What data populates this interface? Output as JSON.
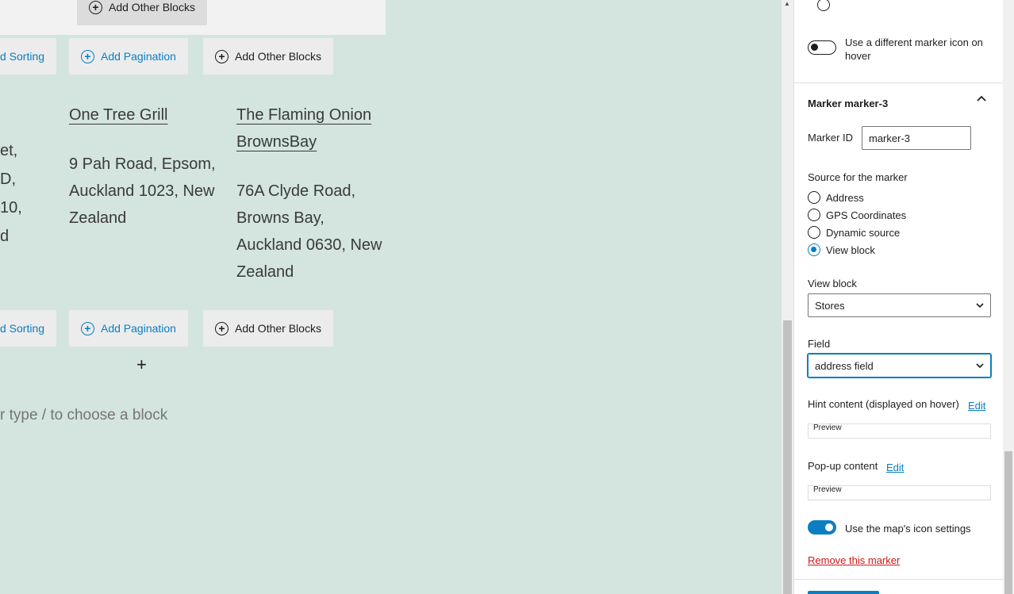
{
  "canvas": {
    "buttons": {
      "add_sorting": "d Sorting",
      "add_pagination": "Add Pagination",
      "add_other_blocks": "Add Other Blocks"
    },
    "stores": [
      {
        "title": "One Tree Grill",
        "address": [
          "9 Pah Road, Epsom,",
          "Auckland 1023, New",
          "Zealand"
        ]
      },
      {
        "title": "The Flaming Onion BrownsBay",
        "title_lines": [
          "The Flaming Onion",
          "BrownsBay"
        ],
        "address": [
          "76A Clyde Road,",
          "Browns Bay,",
          "Auckland 0630, New",
          "Zealand"
        ]
      }
    ],
    "left_fragments": [
      "et,",
      "D,",
      "10,",
      "d"
    ],
    "add_block_symbol": "+",
    "appender_placeholder": "r type / to choose a block"
  },
  "sidebar": {
    "hover_icon_toggle_label_lines": [
      "Use a different marker icon on",
      "hover"
    ],
    "hover_icon_toggle_on": false,
    "marker_section_title": "Marker marker-3",
    "marker_id_label": "Marker ID",
    "marker_id_value": "marker-3",
    "source_label": "Source for the marker",
    "source_options": [
      "Address",
      "GPS Coordinates",
      "Dynamic source",
      "View block"
    ],
    "source_selected": "View block",
    "view_block_label": "View block",
    "view_block_value": "Stores",
    "field_label": "Field",
    "field_value": "address field",
    "hint_label": "Hint content (displayed on hover)",
    "hint_edit": "Edit",
    "hint_preview": "Preview",
    "popup_label": "Pop-up content",
    "popup_edit": "Edit",
    "popup_preview": "Preview",
    "map_icon_toggle_label": "Use the map's icon settings",
    "map_icon_toggle_on": true,
    "remove_marker": "Remove this marker"
  },
  "colors": {
    "canvas_bg": "#d4e4df",
    "accent": "#0a7ec2",
    "danger": "#cc1818"
  }
}
